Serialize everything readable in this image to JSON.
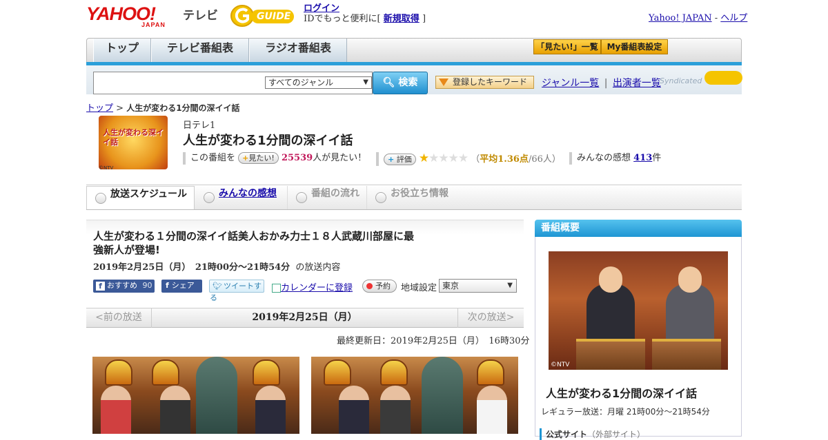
{
  "header": {
    "yahoo_logo": "YAHOO!",
    "yahoo_sub": "JAPAN",
    "tv_label": "テレビ",
    "gguide_logo": "GUIDE",
    "login": "ログイン",
    "login_note_pre": "IDでもっと便利に[",
    "signup": "新規取得",
    "login_note_post": "]",
    "yahoo_japan_link": "Yahoo! JAPAN",
    "sep": " - ",
    "help": "ヘルプ"
  },
  "nav": {
    "tabs": [
      {
        "label": "トップ"
      },
      {
        "label": "テレビ番組表"
      },
      {
        "label": "ラジオ番組表"
      }
    ],
    "miru_button": "「見たい!」一覧",
    "my_button": "My番組表設定"
  },
  "search": {
    "genre_select": "すべてのジャンル",
    "search_button": "検索",
    "keyword_button": "登録したキーワード",
    "genre_list": "ジャンル一覧",
    "divider": "|",
    "cast_list": "出演者一覧",
    "syndicated": "Syndicated"
  },
  "breadcrumb": {
    "top": "トップ",
    "sep": " > ",
    "current": "人生が変わる1分間の深イイ話"
  },
  "program": {
    "logo_text": "人生が変わる深イイ話",
    "logo_credit": "©NTV",
    "station": "日テレ1",
    "title": "人生が変わる1分間の深イイ話",
    "want_pre": "この番組を",
    "want_button": "見たい!",
    "want_count": "25539",
    "want_post": "人が見たい！",
    "rate_button": "評価",
    "rating_avg": "平均1.36点",
    "rating_label_pre": "（",
    "rating_count": "/66人）",
    "rating_stars": 1.36,
    "comments_pre": "みんなの感想",
    "comments_count": "413",
    "comments_post": "件"
  },
  "tabs": [
    {
      "label": "放送スケジュール"
    },
    {
      "label": "みんなの感想"
    },
    {
      "label": "番組の流れ"
    },
    {
      "label": "お役立ち情報"
    }
  ],
  "episode": {
    "title": "人生が変わる１分間の深イイ話美人おかみ力士１８人武蔵川部屋に最強新人が登場!",
    "datetime": "2019年2月25日（月）　21時00分～21時54分",
    "datetime_suffix": "の放送内容",
    "fb_recommend": "おすすめ",
    "fb_count": "90",
    "fb_share": "シェア",
    "tweet": "ツイートする",
    "calendar": "カレンダーに登録",
    "reserve": "予約",
    "region_label": "地域設定",
    "region_value": "東京"
  },
  "pager": {
    "prev": "<前の放送",
    "date": "2019年2月25日（月）",
    "next": "次の放送>"
  },
  "updated": "最終更新日：2019年2月25日（月）　16時30分",
  "sidebar": {
    "header": "番組概要",
    "photo_credit": "©NTV",
    "program_name": "人生が変わる1分間の深イイ話",
    "regular": "レギュラー放送：月曜 21時00分～21時54分",
    "official_site": "公式サイト",
    "official_note": "（外部サイト）"
  },
  "colors": {
    "accent_blue": "#2b9fd9",
    "link": "#1a0dab",
    "pink": "#c1185a",
    "star": "#f0b400"
  }
}
